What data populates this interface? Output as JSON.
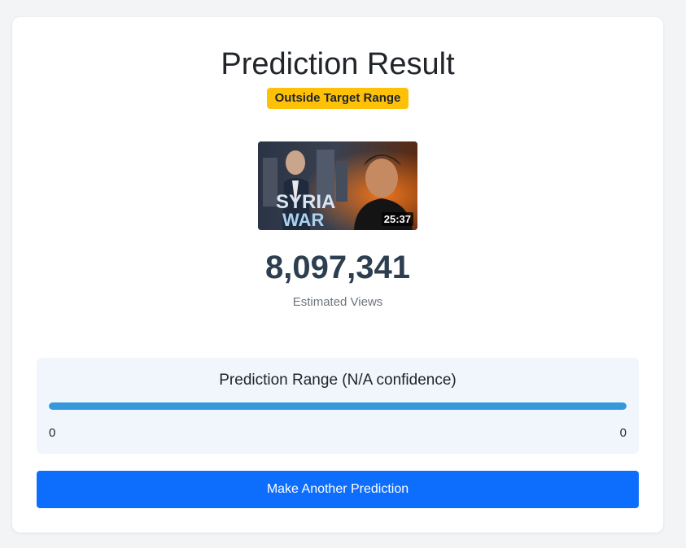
{
  "card": {
    "title": "Prediction Result",
    "badge": "Outside Target Range",
    "thumbnail": {
      "duration": "25:37",
      "overlay_text_line1": "SYRIA",
      "overlay_text_line2": "WAR"
    },
    "views": "8,097,341",
    "views_label": "Estimated Views",
    "range": {
      "title": "Prediction Range (N/A confidence)",
      "min": "0",
      "max": "0",
      "fill_percent": 100
    },
    "action_button": "Make Another Prediction"
  },
  "colors": {
    "badge": "#ffc107",
    "button": "#0d6efd",
    "range_fill": "#3498db",
    "views_text": "#2c3e50"
  }
}
